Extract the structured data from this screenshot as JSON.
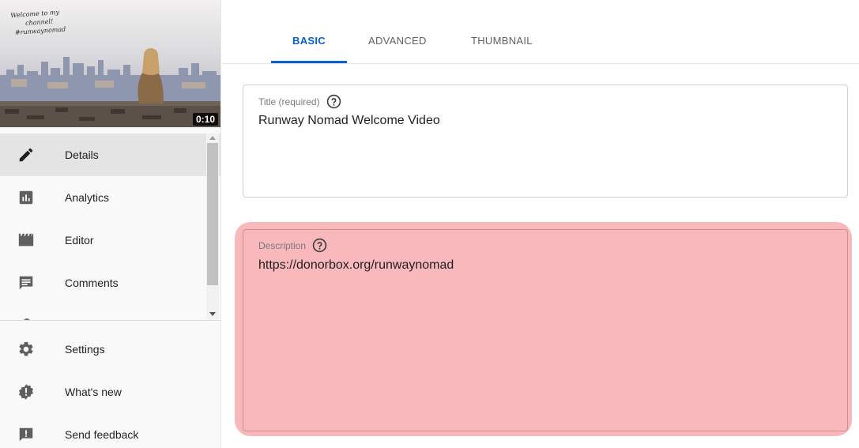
{
  "video": {
    "overlay_lines": [
      "Welcome to my",
      "channel!",
      "#runwaynomad"
    ],
    "duration": "0:10"
  },
  "sidebar": {
    "items": [
      {
        "label": "Details",
        "icon": "pencil-icon",
        "active": true
      },
      {
        "label": "Analytics",
        "icon": "analytics-icon"
      },
      {
        "label": "Editor",
        "icon": "clapperboard-icon"
      },
      {
        "label": "Comments",
        "icon": "comment-icon"
      }
    ],
    "bottom_items": [
      {
        "label": "Settings",
        "icon": "gear-icon"
      },
      {
        "label": "What's new",
        "icon": "new-badge-icon"
      },
      {
        "label": "Send feedback",
        "icon": "feedback-icon"
      }
    ]
  },
  "tabs": [
    {
      "label": "BASIC",
      "active": true
    },
    {
      "label": "ADVANCED"
    },
    {
      "label": "THUMBNAIL"
    }
  ],
  "form": {
    "title_label": "Title (required)",
    "title_value": "Runway Nomad Welcome Video",
    "description_label": "Description",
    "description_value": "https://donorbox.org/runwaynomad"
  },
  "colors": {
    "accent": "#065fd4",
    "highlight": "#f47178"
  }
}
